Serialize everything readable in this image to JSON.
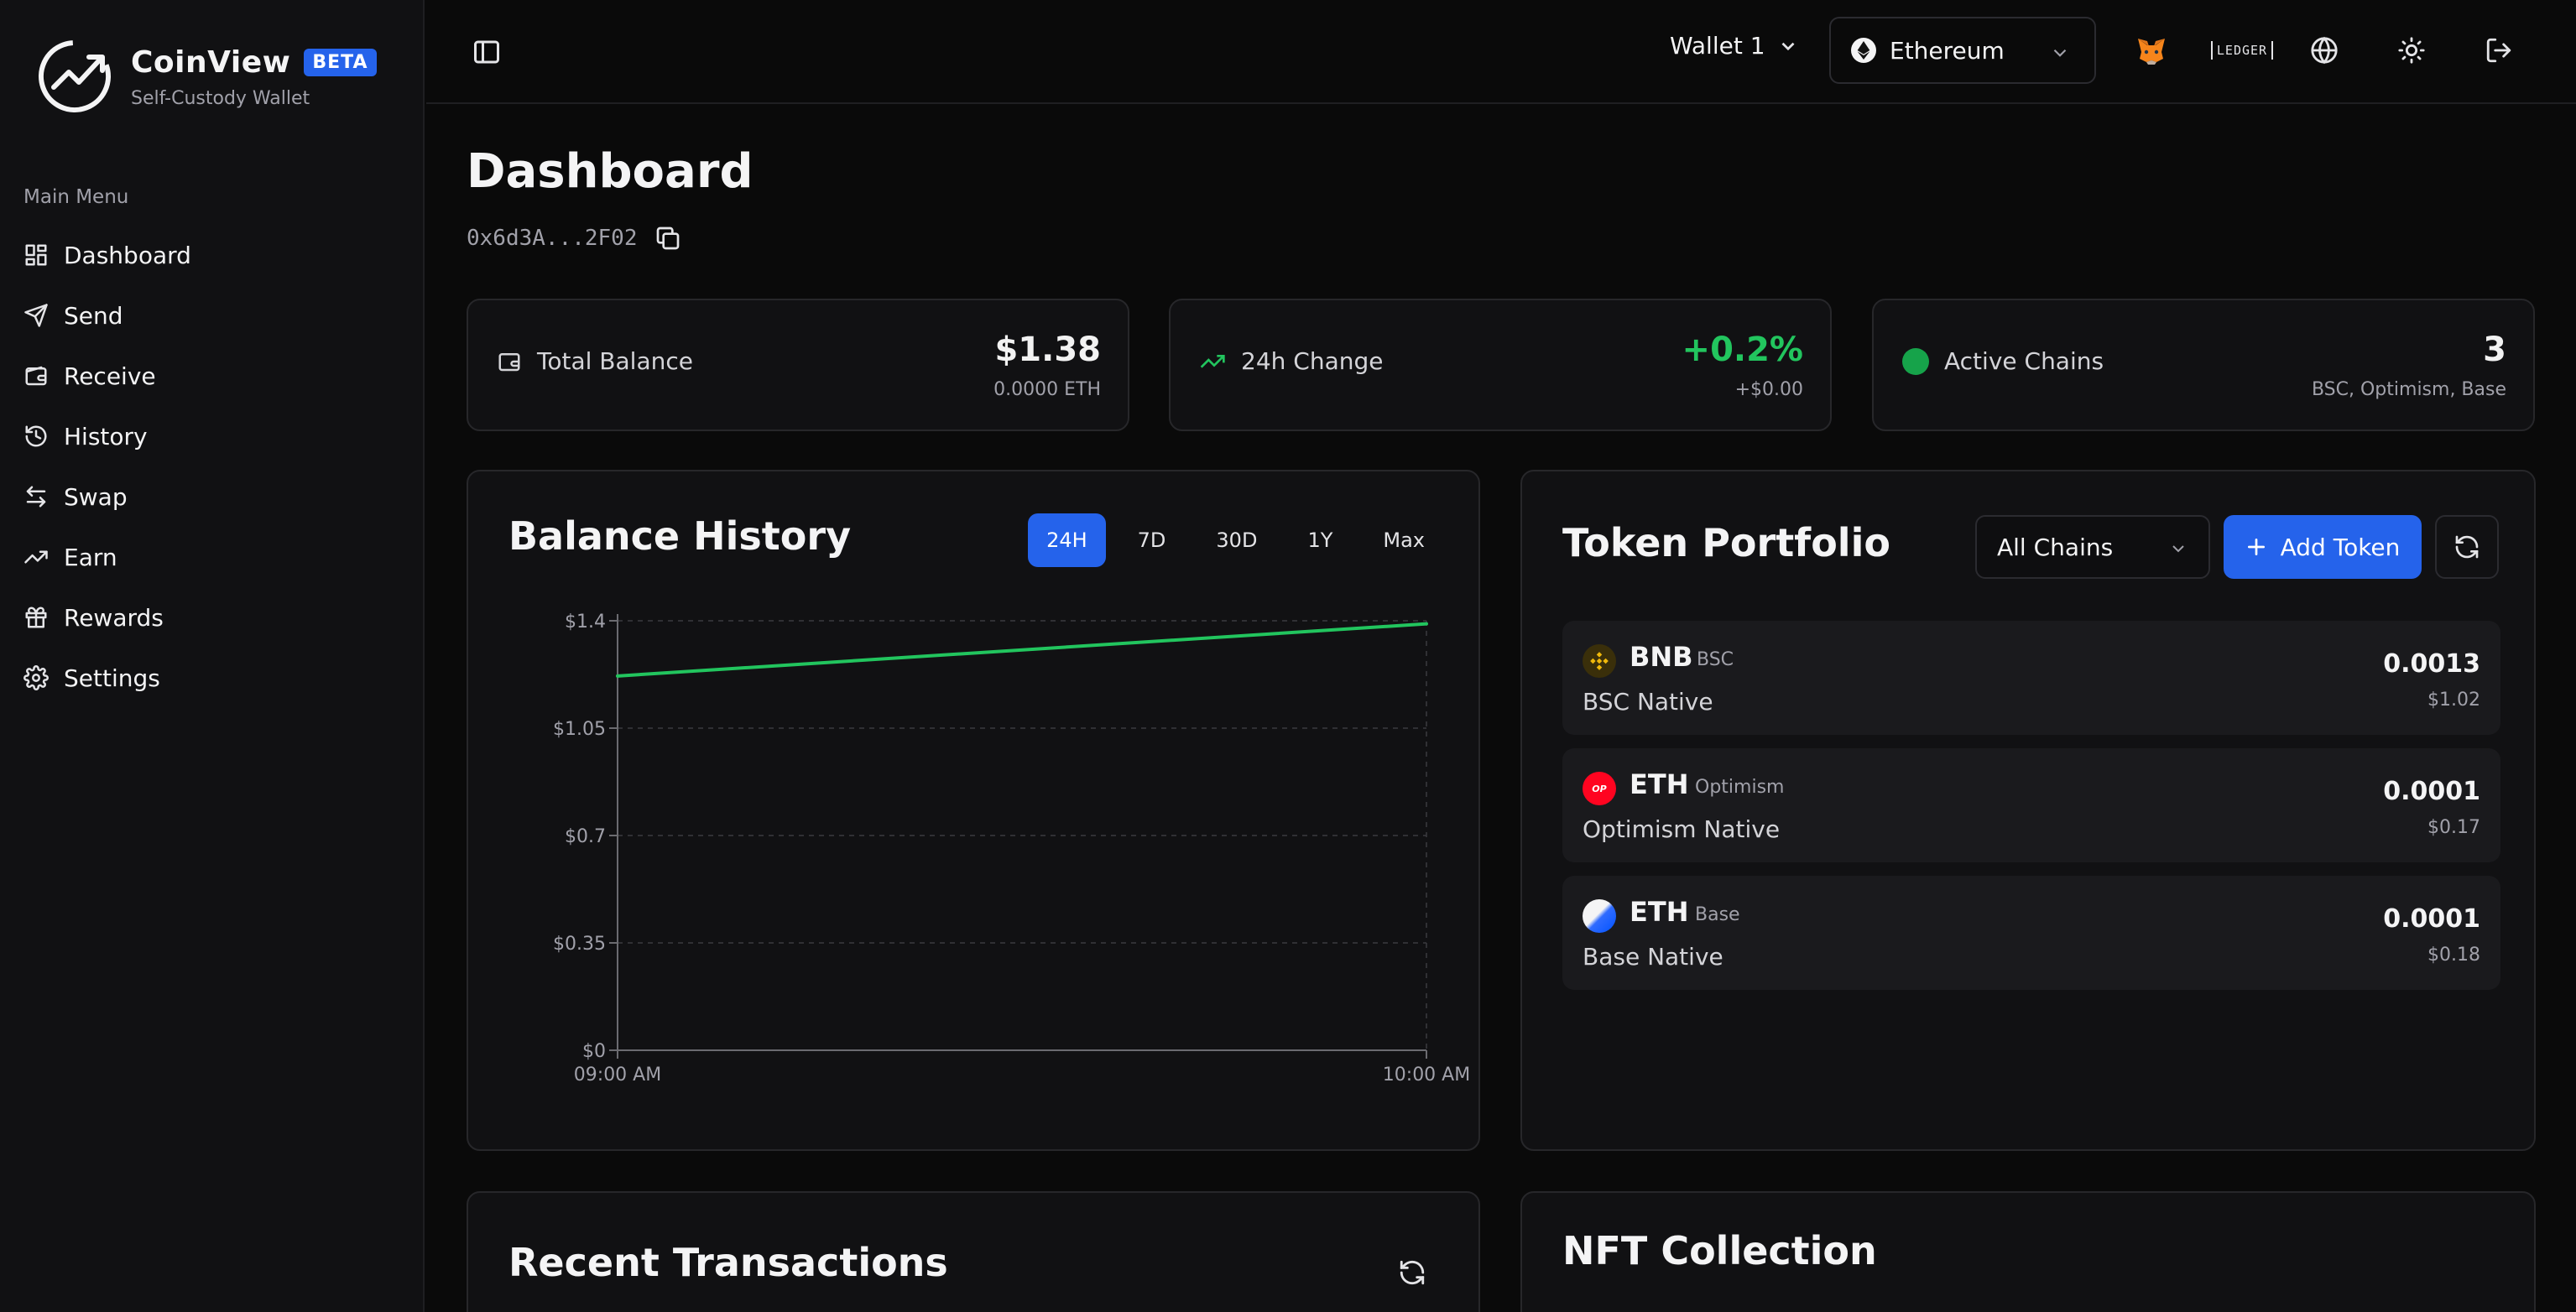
{
  "brand": {
    "name": "CoinView",
    "badge": "BETA",
    "subtitle": "Self-Custody Wallet"
  },
  "sidebar": {
    "section_title": "Main Menu",
    "items": [
      {
        "label": "Dashboard",
        "icon": "dashboard-icon"
      },
      {
        "label": "Send",
        "icon": "send-icon"
      },
      {
        "label": "Receive",
        "icon": "wallet-icon"
      },
      {
        "label": "History",
        "icon": "history-icon"
      },
      {
        "label": "Swap",
        "icon": "swap-icon"
      },
      {
        "label": "Earn",
        "icon": "trending-up-icon"
      },
      {
        "label": "Rewards",
        "icon": "gift-icon"
      },
      {
        "label": "Settings",
        "icon": "gear-icon"
      }
    ]
  },
  "header": {
    "wallet": "Wallet 1",
    "network": "Ethereum",
    "icons": [
      "metamask-icon",
      "ledger-icon",
      "globe-icon",
      "sun-icon",
      "logout-icon"
    ]
  },
  "page": {
    "title": "Dashboard",
    "address": "0x6d3A...2F02"
  },
  "stats": {
    "balance": {
      "label": "Total Balance",
      "value": "$1.38",
      "sub": "0.0000 ETH"
    },
    "change": {
      "label": "24h Change",
      "value": "+0.2%",
      "sub": "+$0.00"
    },
    "chains": {
      "label": "Active Chains",
      "value": "3",
      "sub": "BSC, Optimism, Base"
    }
  },
  "balance_history": {
    "title": "Balance History",
    "ranges": [
      "24H",
      "7D",
      "30D",
      "1Y",
      "Max"
    ],
    "active_range": "24H"
  },
  "chart_data": {
    "type": "line",
    "x": [
      "09:00 AM",
      "10:00 AM"
    ],
    "series": [
      {
        "values": [
          1.22,
          1.39
        ],
        "color": "#22c55e"
      }
    ],
    "ylim": [
      0,
      1.4
    ],
    "yticks": [
      0,
      0.35,
      0.7,
      1.05,
      1.4
    ],
    "ytick_labels": [
      "$0",
      "$0.35",
      "$0.7",
      "$1.05",
      "$1.4"
    ],
    "xtick_labels": [
      "09:00 AM",
      "10:00 AM"
    ],
    "grid": true
  },
  "token_portfolio": {
    "title": "Token Portfolio",
    "filter": "All Chains",
    "add_label": "Add Token",
    "tokens": [
      {
        "symbol": "BNB",
        "chain": "BSC",
        "native": "BSC Native",
        "amount": "0.0013",
        "usd": "$1.02",
        "color": "#f0b90b"
      },
      {
        "symbol": "ETH",
        "chain": "Optimism",
        "native": "Optimism Native",
        "amount": "0.0001",
        "usd": "$0.17",
        "color": "#ff0420"
      },
      {
        "symbol": "ETH",
        "chain": "Base",
        "native": "Base Native",
        "amount": "0.0001",
        "usd": "$0.18",
        "color": "#0052ff"
      }
    ]
  },
  "recent_tx": {
    "title": "Recent Transactions"
  },
  "nft": {
    "title": "NFT Collection"
  },
  "colors": {
    "accent": "#2563eb",
    "positive": "#22c55e",
    "background": "#0a0a0a",
    "card": "#111113"
  }
}
